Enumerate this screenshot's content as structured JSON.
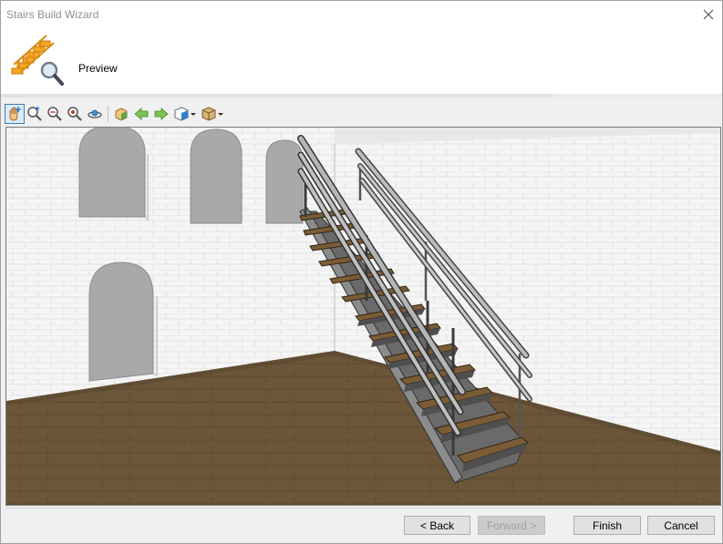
{
  "window": {
    "title": "Stairs Build Wizard"
  },
  "header": {
    "title": "Preview",
    "icon": "stairs-preview-icon"
  },
  "toolbar": {
    "items": [
      {
        "name": "pan-hand-icon",
        "active": true
      },
      {
        "name": "zoom-in-icon"
      },
      {
        "name": "zoom-out-icon"
      },
      {
        "name": "zoom-fit-icon"
      },
      {
        "name": "orbit-icon"
      },
      {
        "name": "object-view-icon"
      },
      {
        "name": "arrow-left-icon"
      },
      {
        "name": "arrow-right-icon"
      },
      {
        "name": "view-cube-icon"
      },
      {
        "name": "material-box-icon"
      }
    ]
  },
  "buttons": {
    "back": "< Back",
    "forward": "Forward >",
    "finish": "Finish",
    "cancel": "Cancel"
  },
  "colors": {
    "accent": "#3c7fb1",
    "floor": "#6b5639",
    "wall": "#f4f4f4",
    "window_niche": "#a9a9a9"
  }
}
